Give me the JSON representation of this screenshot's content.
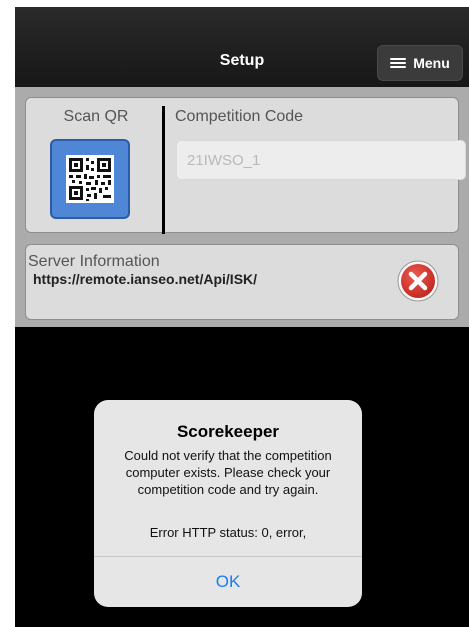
{
  "navbar": {
    "title": "Setup",
    "menu_label": "Menu"
  },
  "qr_section": {
    "scan_label": "Scan QR",
    "code_label": "Competition Code",
    "code_value": "21IWSO_1"
  },
  "server": {
    "label": "Server Information",
    "url": "https://remote.ianseo.net/Api/ISK/"
  },
  "dialog": {
    "title": "Scorekeeper",
    "message": "Could not verify that the competition computer exists. Please check your competition code and try again.",
    "error": "Error HTTP status: 0, error,",
    "ok_label": "OK"
  },
  "colors": {
    "accent": "#1a7cf5",
    "qr_button": "#4f87d6",
    "clear_button": "#d9342c"
  }
}
